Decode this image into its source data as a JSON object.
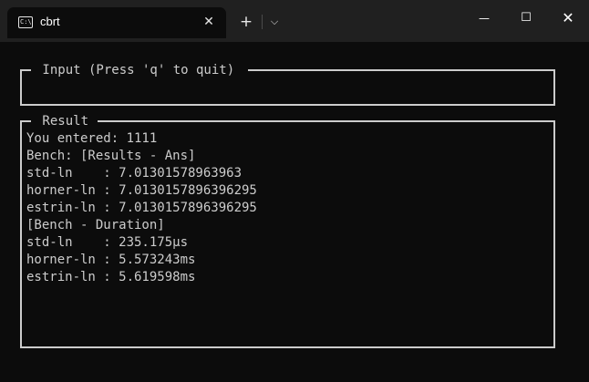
{
  "window": {
    "tab_title": "cbrt",
    "tab_icon": "terminal-icon",
    "tab_close_glyph": "✕",
    "new_tab_glyph": "+",
    "dropdown_glyph": "⌵",
    "minimize_glyph": "—",
    "maximize_glyph": "☐",
    "close_glyph": "✕"
  },
  "input_panel": {
    "title": " Input (Press 'q' to quit) ",
    "value": ""
  },
  "result_panel": {
    "title": " Result ",
    "lines": [
      "You entered: 1111",
      "Bench: [Results - Ans]",
      "std-ln    : 7.01301578963963",
      "horner-ln : 7.0130157896396295",
      "estrin-ln : 7.0130157896396295",
      "[Bench - Duration]",
      "std-ln    : 235.175µs",
      "horner-ln : 5.573243ms",
      "estrin-ln : 5.619598ms"
    ]
  },
  "colors": {
    "background": "#0c0c0c",
    "titlebar": "#202020",
    "text": "#cccccc"
  }
}
